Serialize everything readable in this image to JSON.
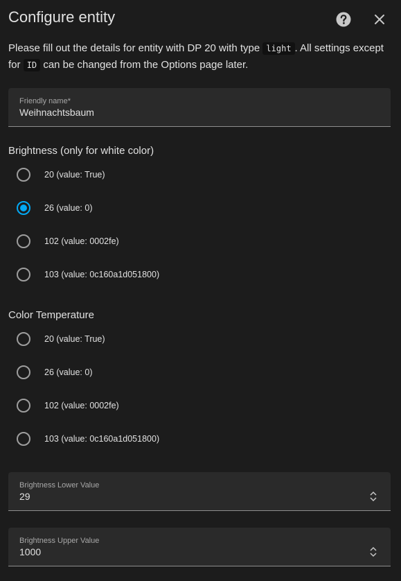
{
  "dialog": {
    "title": "Configure entity",
    "help_icon": "help-circle-icon",
    "close_icon": "close-icon"
  },
  "description": {
    "part1": "Please fill out the details for entity with DP 20 with type",
    "code1": "light",
    "part2": ". All settings except for",
    "code2": "ID",
    "part3": "can be changed from the Options page later."
  },
  "friendly_name": {
    "label": "Friendly name*",
    "value": "Weihnachtsbaum"
  },
  "brightness": {
    "title": "Brightness (only for white color)",
    "options": [
      {
        "label": "20 (value: True)",
        "checked": false
      },
      {
        "label": "26 (value: 0)",
        "checked": true
      },
      {
        "label": "102 (value: 0002fe)",
        "checked": false
      },
      {
        "label": "103 (value: 0c160a1d051800)",
        "checked": false
      }
    ]
  },
  "color_temperature": {
    "title": "Color Temperature",
    "options": [
      {
        "label": "20 (value: True)",
        "checked": false
      },
      {
        "label": "26 (value: 0)",
        "checked": false
      },
      {
        "label": "102 (value: 0002fe)",
        "checked": false
      },
      {
        "label": "103 (value: 0c160a1d051800)",
        "checked": false
      }
    ]
  },
  "brightness_lower": {
    "label": "Brightness Lower Value",
    "value": "29"
  },
  "brightness_upper": {
    "label": "Brightness Upper Value",
    "value": "1000"
  },
  "colors": {
    "accent": "#03a9f4",
    "background": "#1c1c1c",
    "field_background": "#2a2a2a"
  }
}
